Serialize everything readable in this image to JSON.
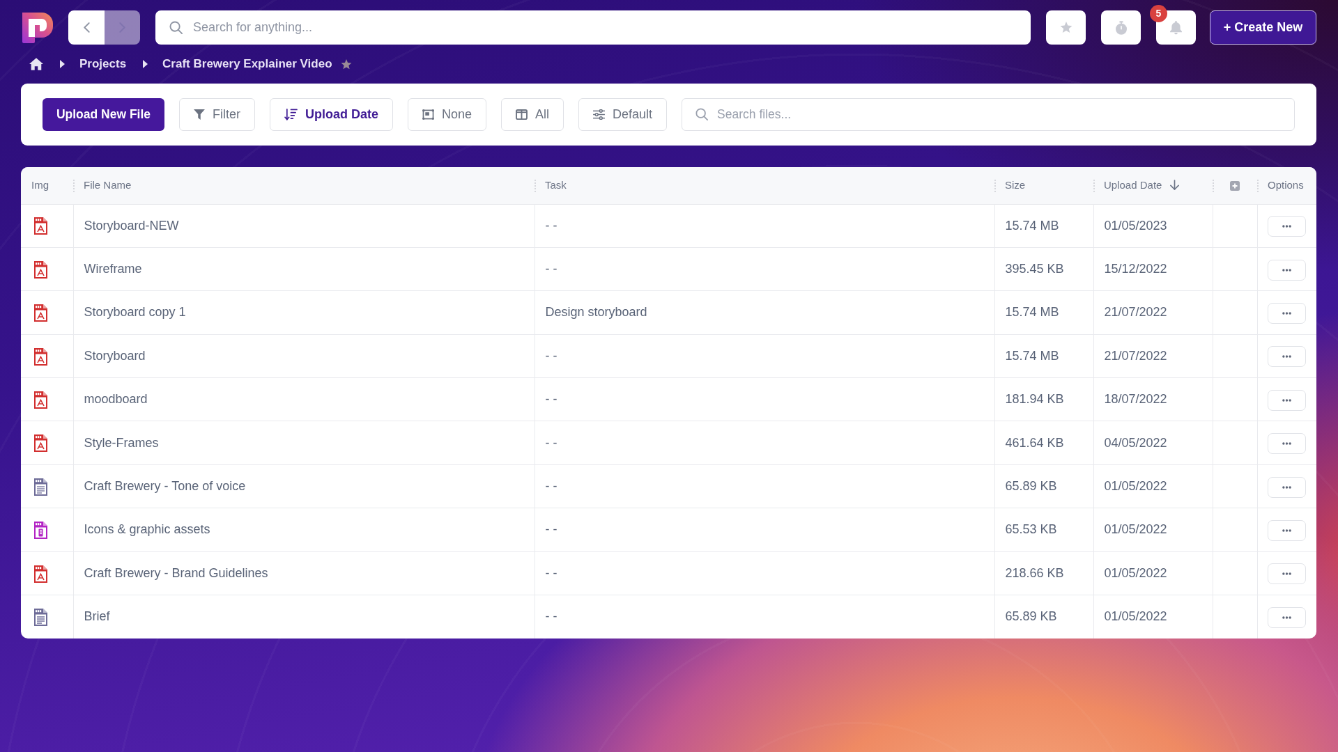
{
  "top_bar": {
    "nav": [
      {
        "kind": "back",
        "disabled": false
      },
      {
        "kind": "forward",
        "disabled": true
      }
    ],
    "search": {
      "placeholder": "Search for anything..."
    },
    "actions": [
      {
        "kind": "favorites"
      },
      {
        "kind": "timer"
      },
      {
        "kind": "notifications",
        "badge": "5"
      }
    ],
    "create_label": "+ Create New"
  },
  "breadcrumb": {
    "items": [
      "Projects",
      "Craft Brewery Explainer Video"
    ]
  },
  "toolbar": {
    "upload_label": "Upload New File",
    "buttons": [
      {
        "kind": "filter",
        "label": "Filter",
        "active": false
      },
      {
        "kind": "sort",
        "label": "Upload Date",
        "active": true
      },
      {
        "kind": "preview",
        "label": "None",
        "active": false
      },
      {
        "kind": "columns",
        "label": "All",
        "active": false
      },
      {
        "kind": "density",
        "label": "Default",
        "active": false
      }
    ],
    "search": {
      "placeholder": "Search files..."
    }
  },
  "table": {
    "columns": [
      {
        "kind": "text",
        "label": "Img",
        "sorted": false
      },
      {
        "kind": "text",
        "label": "File Name",
        "sorted": false
      },
      {
        "kind": "text",
        "label": "Task",
        "sorted": false
      },
      {
        "kind": "text",
        "label": "Size",
        "sorted": false
      },
      {
        "kind": "text",
        "label": "Upload Date",
        "sorted": true
      },
      {
        "kind": "add",
        "sorted": false
      },
      {
        "kind": "text",
        "label": "Options",
        "sorted": false
      }
    ],
    "rows": [
      {
        "kind": "pdf",
        "name": "Storyboard-NEW",
        "task": "- -",
        "size": "15.74 MB",
        "upload_date": "01/05/2023"
      },
      {
        "kind": "pdf",
        "name": "Wireframe",
        "task": "- -",
        "size": "395.45 KB",
        "upload_date": "15/12/2022"
      },
      {
        "kind": "pdf",
        "name": "Storyboard copy 1",
        "task": "Design storyboard",
        "size": "15.74 MB",
        "upload_date": "21/07/2022"
      },
      {
        "kind": "pdf",
        "name": "Storyboard",
        "task": "- -",
        "size": "15.74 MB",
        "upload_date": "21/07/2022"
      },
      {
        "kind": "pdf",
        "name": "moodboard",
        "task": "- -",
        "size": "181.94 KB",
        "upload_date": "18/07/2022"
      },
      {
        "kind": "pdf",
        "name": "Style-Frames",
        "task": "- -",
        "size": "461.64 KB",
        "upload_date": "04/05/2022"
      },
      {
        "kind": "docx",
        "name": "Craft Brewery - Tone of voice",
        "task": "- -",
        "size": "65.89 KB",
        "upload_date": "01/05/2022"
      },
      {
        "kind": "zip",
        "name": "Icons & graphic assets",
        "task": "- -",
        "size": "65.53 KB",
        "upload_date": "01/05/2022"
      },
      {
        "kind": "pdf",
        "name": "Craft Brewery - Brand Guidelines",
        "task": "- -",
        "size": "218.66 KB",
        "upload_date": "01/05/2022"
      },
      {
        "kind": "docx",
        "name": "Brief",
        "task": "- -",
        "size": "65.89 KB",
        "upload_date": "01/05/2022"
      }
    ]
  }
}
